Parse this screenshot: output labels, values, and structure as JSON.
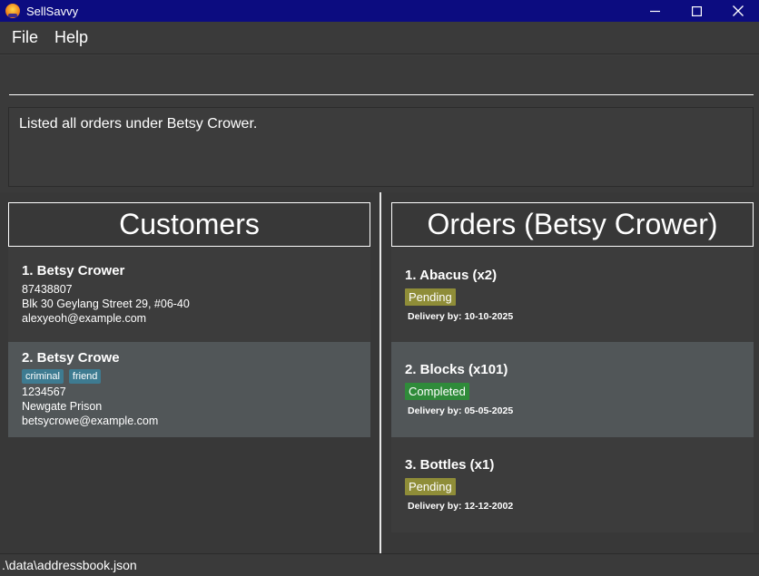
{
  "window": {
    "title": "SellSavvy",
    "icon": "app-logo-icon"
  },
  "menu": {
    "items": [
      "File",
      "Help"
    ]
  },
  "command": {
    "value": "",
    "placeholder": ""
  },
  "result": {
    "message": "Listed all orders under Betsy Crower."
  },
  "customers": {
    "title": "Customers",
    "items": [
      {
        "name": "1. Betsy Crower",
        "tags": [],
        "phone": "87438807",
        "address": "Blk 30 Geylang Street 29, #06-40",
        "email": "alexyeoh@example.com"
      },
      {
        "name": "2. Betsy Crowe",
        "tags": [
          "criminal",
          "friend"
        ],
        "phone": "1234567",
        "address": "Newgate Prison",
        "email": "betsycrowe@example.com"
      }
    ]
  },
  "orders": {
    "title": "Orders (Betsy Crower)",
    "items": [
      {
        "name": "1. Abacus (x2)",
        "status": "Pending",
        "delivery": "Delivery by: 10-10-2025"
      },
      {
        "name": "2. Blocks (x101)",
        "status": "Completed",
        "delivery": "Delivery by: 05-05-2025"
      },
      {
        "name": "3. Bottles (x1)",
        "status": "Pending",
        "delivery": "Delivery by: 12-12-2002"
      }
    ]
  },
  "statusbar": {
    "path": ".\\data\\addressbook.json"
  },
  "colors": {
    "titlebar": "#0c0c80",
    "background": "#3f3f3f",
    "tag": "#3e7b91",
    "pending": "#8f8d38",
    "completed": "#2f8b3a",
    "selected_card": "#515658"
  }
}
